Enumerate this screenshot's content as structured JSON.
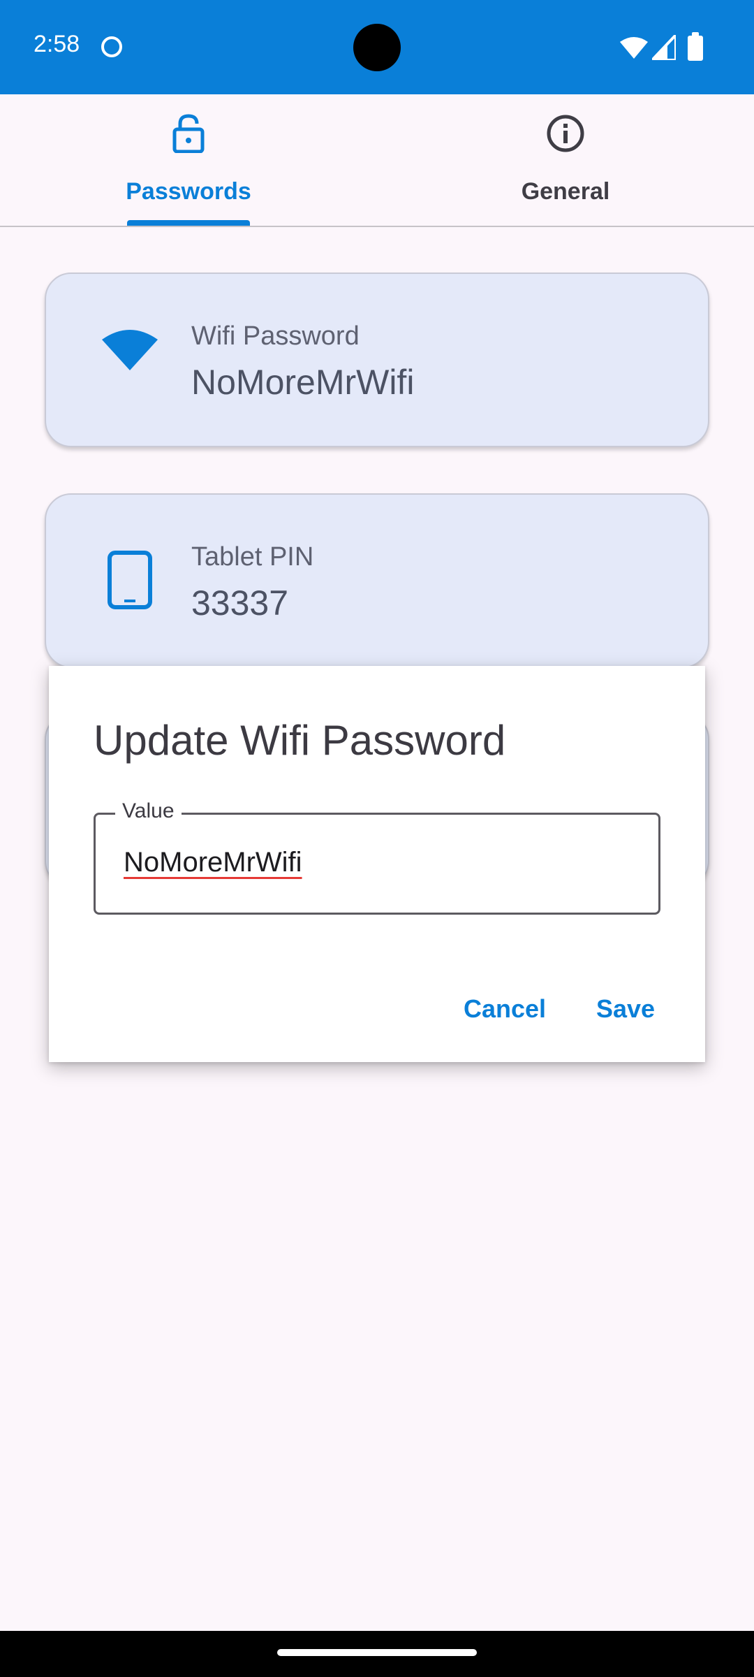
{
  "status_bar": {
    "time": "2:58"
  },
  "tabs": [
    {
      "label": "Passwords",
      "icon": "lock-open-icon",
      "selected": true
    },
    {
      "label": "General",
      "icon": "info-icon",
      "selected": false
    }
  ],
  "cards": [
    {
      "title": "Wifi Password",
      "value": "NoMoreMrWifi",
      "icon": "wifi-icon"
    },
    {
      "title": "Tablet PIN",
      "value": "33337",
      "icon": "tablet-icon"
    }
  ],
  "dialog": {
    "title": "Update Wifi Password",
    "field_label": "Value",
    "field_value": "NoMoreMrWifi",
    "cancel_label": "Cancel",
    "save_label": "Save"
  },
  "colors": {
    "accent": "#0a7fd8",
    "background": "#fcf6fb",
    "card": "#e4e9f9"
  }
}
